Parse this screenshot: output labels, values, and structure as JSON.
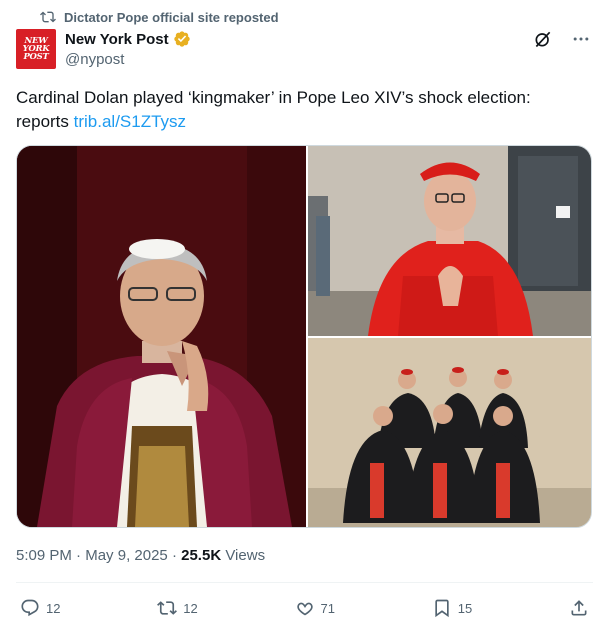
{
  "repost": {
    "text": "Dictator Pope official site reposted"
  },
  "author": {
    "name": "New York Post",
    "handle": "@nypost",
    "avatar_lines": [
      "NEW",
      "YORK",
      "POST"
    ],
    "brand_color": "#d81f26"
  },
  "tweet": {
    "text": "Cardinal Dolan played ‘kingmaker’ in Pope Leo XIV’s shock election: reports ",
    "link": "trib.al/S1ZTysz"
  },
  "meta": {
    "time": "5:09 PM",
    "date": "May 9, 2025",
    "views_count": "25.5K",
    "views_label": "Views"
  },
  "actions": {
    "replies": "12",
    "reposts": "12",
    "likes": "71",
    "bookmarks": "15"
  },
  "colors": {
    "link": "#1d9bf0",
    "secondary_text": "#536471",
    "verified": "#e8b021"
  },
  "icons": [
    "repost-icon",
    "verified-badge-icon",
    "grok-icon",
    "more-icon",
    "reply-icon",
    "retweet-icon",
    "like-icon",
    "bookmark-icon",
    "share-icon"
  ]
}
